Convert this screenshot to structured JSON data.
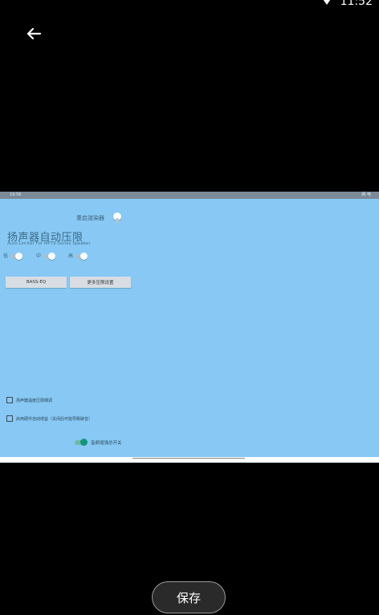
{
  "status_bar": {
    "time": "11:52"
  },
  "preview": {
    "status_time": "19:56",
    "status_icons": "网 电",
    "restart_label": "重启渲染器",
    "title": "扬声器自动压限",
    "subtitle": "Auto Limiter For MFT9-Series Speaker",
    "bands": [
      {
        "label": "低"
      },
      {
        "label": "中"
      },
      {
        "label": "高"
      }
    ],
    "buttons": {
      "bass_eq": "BASS-EQ",
      "more_settings": "更多压限设置"
    },
    "checkboxes": [
      {
        "label": "扬声器温度压限细调"
      },
      {
        "label": "启用硬件自动增益（关闭后可能导致破音）"
      }
    ],
    "master_switch_label": "音频增强总开关"
  },
  "save_button": {
    "label": "保存"
  },
  "colors": {
    "preview_bg": "#87c9f4",
    "accent": "#10977a"
  }
}
